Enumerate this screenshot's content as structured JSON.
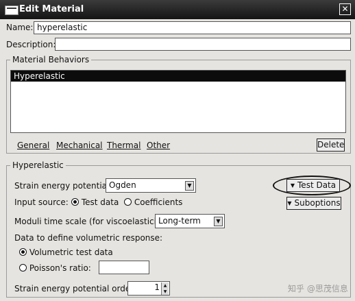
{
  "window": {
    "title": "Edit Material"
  },
  "name": {
    "label": "Name:",
    "value": "hyperelastic"
  },
  "description": {
    "label": "Description:",
    "value": ""
  },
  "material_behaviors": {
    "title": "Material Behaviors",
    "items": [
      "Hyperelastic"
    ],
    "menus": [
      "General",
      "Mechanical",
      "Thermal",
      "Other"
    ],
    "delete_label": "Delete"
  },
  "hyperelastic": {
    "title": "Hyperelastic",
    "strain_energy_label": "Strain energy potential:",
    "strain_energy_value": "Ogden",
    "input_source_label": "Input source:",
    "input_test_data": "Test data",
    "input_coefficients": "Coefficients",
    "moduli_label": "Moduli time scale (for viscoelasticity):",
    "moduli_value": "Long-term",
    "volumetric_label": "Data to define volumetric response:",
    "volumetric_test_data": "Volumetric test data",
    "poisson_label": "Poisson's ratio:",
    "poisson_value": "",
    "order_label": "Strain energy potential order:",
    "order_value": "1",
    "test_data_button": "Test Data",
    "suboptions_button": "Suboptions"
  },
  "watermark": "知乎 @思茂信息"
}
